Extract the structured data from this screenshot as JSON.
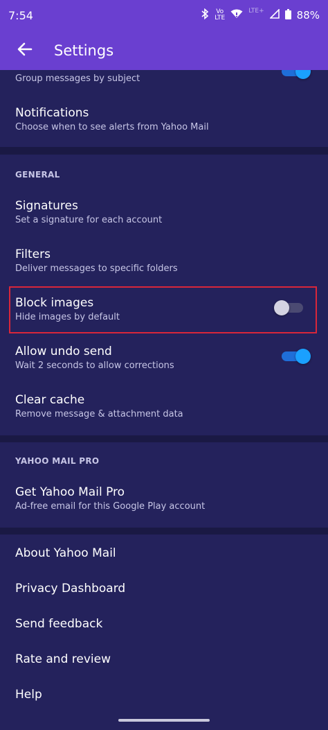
{
  "status_bar": {
    "time": "7:54",
    "volte_top": "Vo",
    "volte_bottom": "LTE",
    "lte_label": "LTE+",
    "battery": "88%"
  },
  "app_bar": {
    "title": "Settings"
  },
  "items": {
    "group_messages": {
      "subtitle": "Group messages by subject",
      "toggle_on": true
    },
    "notifications": {
      "title": "Notifications",
      "subtitle": "Choose when to see alerts from Yahoo Mail"
    },
    "signatures": {
      "title": "Signatures",
      "subtitle": "Set a signature for each account"
    },
    "filters": {
      "title": "Filters",
      "subtitle": "Deliver messages to specific folders"
    },
    "block_images": {
      "title": "Block images",
      "subtitle": "Hide images by default",
      "toggle_on": false
    },
    "undo_send": {
      "title": "Allow undo send",
      "subtitle": "Wait 2 seconds to allow corrections",
      "toggle_on": true
    },
    "clear_cache": {
      "title": "Clear cache",
      "subtitle": "Remove message & attachment data"
    },
    "get_pro": {
      "title": "Get Yahoo Mail Pro",
      "subtitle": "Ad-free email for this Google Play account"
    },
    "about": {
      "title": "About Yahoo Mail"
    },
    "privacy": {
      "title": "Privacy Dashboard"
    },
    "feedback": {
      "title": "Send feedback"
    },
    "rate": {
      "title": "Rate and review"
    },
    "help": {
      "title": "Help"
    }
  },
  "sections": {
    "general": "GENERAL",
    "pro": "YAHOO MAIL PRO"
  },
  "icons": {
    "back": "arrow-left-icon",
    "bluetooth": "bluetooth-icon",
    "wifi": "wifi-icon",
    "signal": "signal-icon",
    "battery": "battery-icon"
  },
  "colors": {
    "header": "#6a3fd0",
    "background": "#24225c",
    "divider": "#1a1944",
    "toggle_on": "#1aa0ff",
    "highlight": "#d9263a"
  }
}
